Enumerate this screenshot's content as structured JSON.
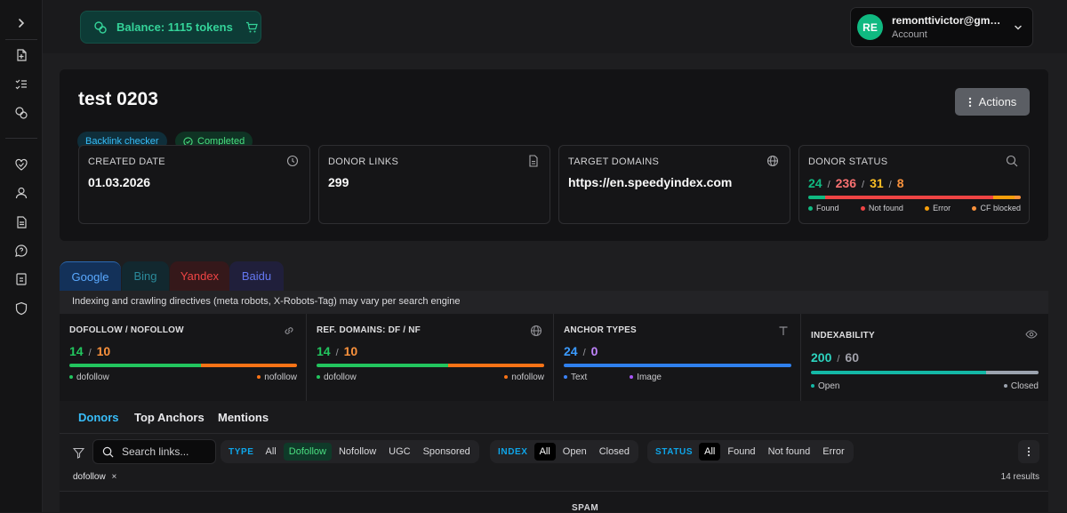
{
  "topbar": {
    "balance": "Balance: 1115 tokens",
    "account": {
      "initials": "RE",
      "email": "remonttivictor@gmai...",
      "label": "Account"
    }
  },
  "sidebar": {
    "icons": [
      "chevron-right-icon",
      "add-document-icon",
      "task-list-icon",
      "coins-icon",
      "heart-check-icon",
      "user-icon",
      "document-icon",
      "help-chat-icon",
      "contact-book-icon",
      "shield-icon"
    ]
  },
  "project": {
    "title": "test 0203",
    "type_badge": "Backlink checker",
    "status_badge": "Completed",
    "actions_label": "Actions"
  },
  "stats": {
    "created": {
      "label": "CREATED DATE",
      "value": "01.03.2026"
    },
    "donor_links": {
      "label": "DONOR LINKS",
      "value": "299"
    },
    "target_domains": {
      "label": "TARGET DOMAINS",
      "value": "https://en.speedyindex.com"
    },
    "donor_status": {
      "label": "DONOR STATUS",
      "found": "24",
      "not_found": "236",
      "error": "31",
      "cf_blocked": "8",
      "sep": "/",
      "legend": {
        "found": "Found",
        "not_found": "Not found",
        "error": "Error",
        "cf_blocked": "CF blocked"
      },
      "colors": {
        "found": "#10b981",
        "not_found": "#ef4444",
        "error": "#f59e0b",
        "cf_blocked": "#fb923c"
      },
      "shares": {
        "found": 0.08,
        "not_found": 0.79,
        "error": 0.1,
        "cf_blocked": 0.03
      }
    }
  },
  "engines": {
    "tabs": [
      "Google",
      "Bing",
      "Yandex",
      "Baidu"
    ],
    "active": "Google",
    "note": "Indexing and crawling directives (meta robots, X-Robots-Tag) may vary per search engine"
  },
  "metrics": {
    "dofollow": {
      "label": "DOFOLLOW / NOFOLLOW",
      "a": "14",
      "b": "10",
      "leg_a": "dofollow",
      "leg_b": "nofollow",
      "share_a": 0.58
    },
    "refdomains": {
      "label": "REF. DOMAINS: DF / NF",
      "a": "14",
      "b": "10",
      "leg_a": "dofollow",
      "leg_b": "nofollow",
      "share_a": 0.58
    },
    "anchors": {
      "label": "ANCHOR TYPES",
      "a": "24",
      "b": "0",
      "leg_a": "Text",
      "leg_b": "Image",
      "share_a": 1.0
    },
    "indexability": {
      "label": "INDEXABILITY",
      "a": "200",
      "b": "60",
      "leg_a": "Open",
      "leg_b": "Closed",
      "share_a": 0.77
    },
    "sep": "/"
  },
  "tabs": {
    "donors": "Donors",
    "top_anchors": "Top Anchors",
    "mentions": "Mentions"
  },
  "filters": {
    "search_placeholder": "Search links...",
    "type": {
      "label": "TYPE",
      "options": [
        "All",
        "Dofollow",
        "Nofollow",
        "UGC",
        "Sponsored"
      ],
      "selected": "Dofollow"
    },
    "index": {
      "label": "INDEX",
      "options": [
        "All",
        "Open",
        "Closed"
      ],
      "selected": "All"
    },
    "status": {
      "label": "STATUS",
      "options": [
        "All",
        "Found",
        "Not found",
        "Error"
      ],
      "selected": "All"
    },
    "active_chip": "dofollow",
    "chip_remove": "×",
    "results": "14 results"
  },
  "table": {
    "first_header": "SPAM"
  }
}
